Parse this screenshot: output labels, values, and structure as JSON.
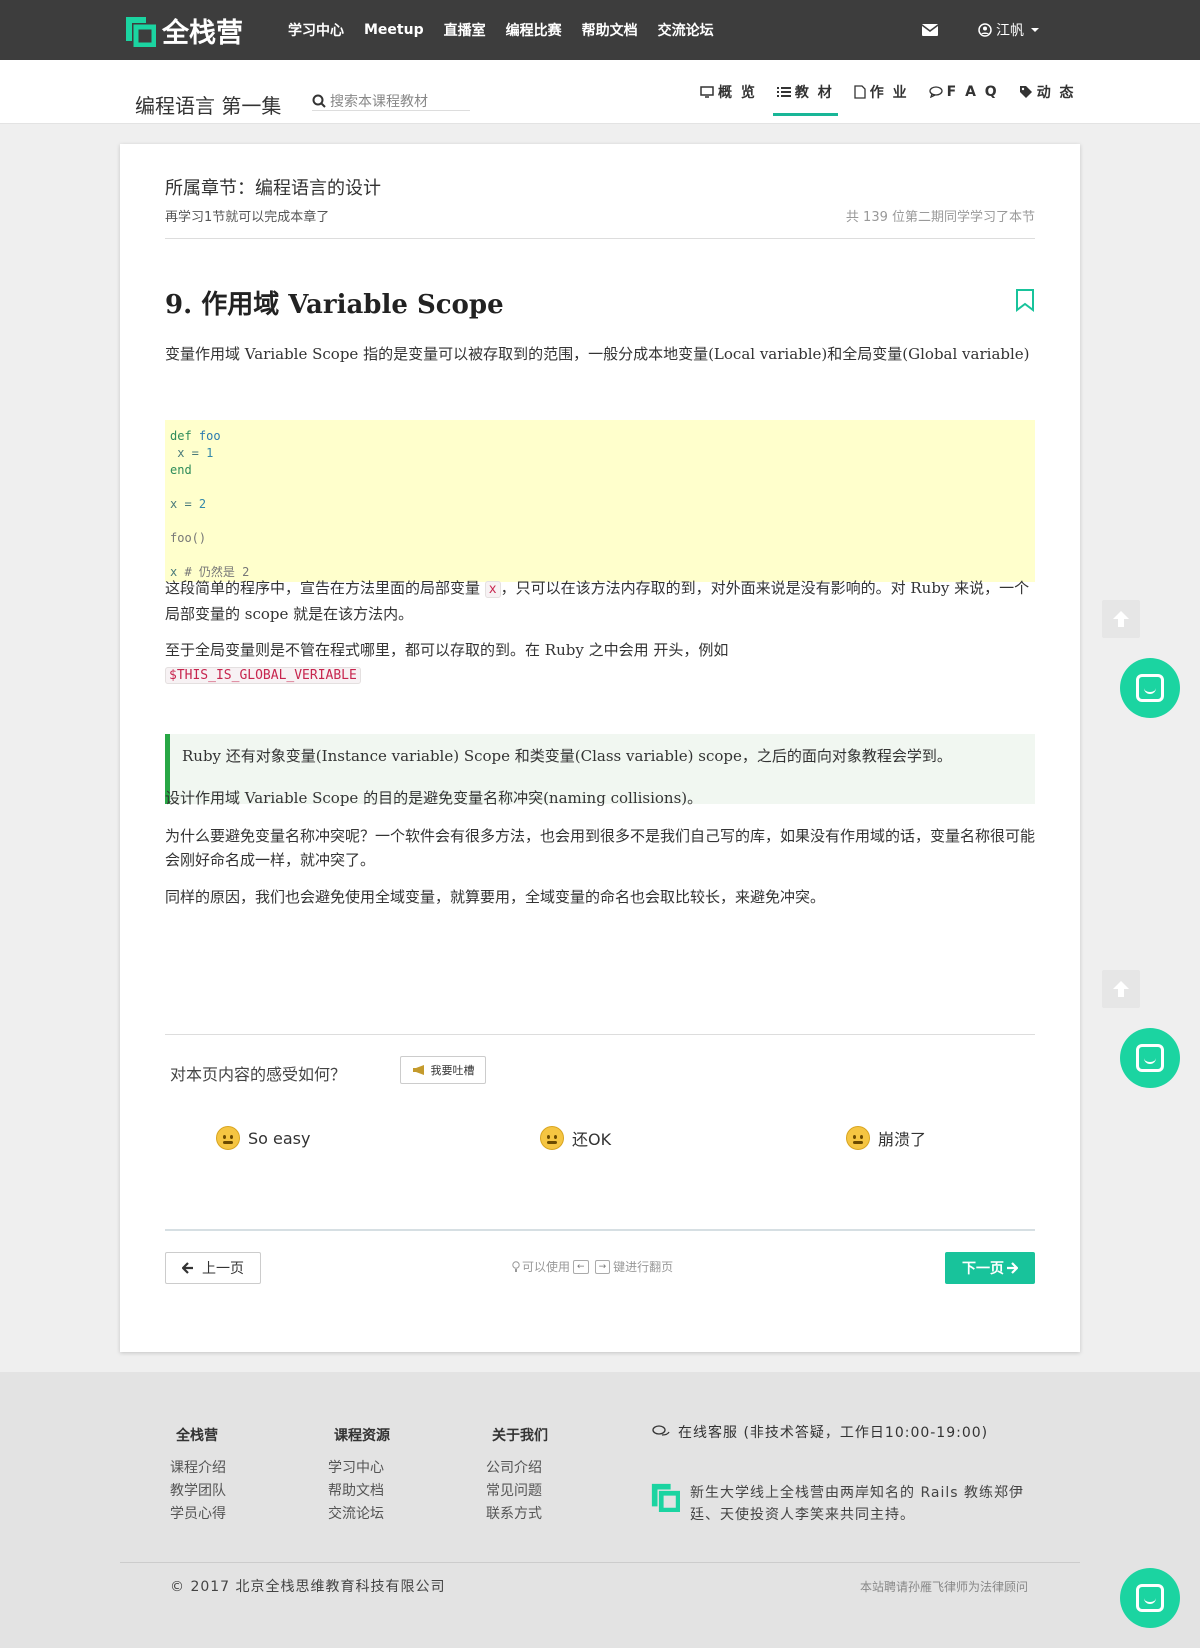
{
  "topnav": {
    "brand": "全栈营",
    "links": [
      "学习中心",
      "Meetup",
      "直播室",
      "编程比赛",
      "帮助文档",
      "交流论坛"
    ],
    "user": "江帆"
  },
  "subnav": {
    "course_title": "编程语言 第一集",
    "search_placeholder": "搜索本课程教材",
    "tabs": [
      "概 览",
      "教 材",
      "作 业",
      "F A Q",
      "动 态"
    ],
    "active_tab": 1
  },
  "lesson": {
    "chapter": "所属章节：编程语言的设计",
    "remaining": "再学习1节就可以完成本章了",
    "learners": "共 139 位第二期同学学习了本节",
    "title": "9. 作用域 Variable Scope",
    "p1": "变量作用域 Variable Scope 指的是变量可以被存取到的范围，一般分成本地变量(Local variable)和全局变量(Global variable)",
    "code": {
      "l1a": "def",
      "l1b": " foo",
      "l2a": " x = ",
      "l2b": "1",
      "l3": "end",
      "l5a": "x = ",
      "l5b": "2",
      "l7": "foo()",
      "l9a": "x ",
      "l9b": "# 仍然是 2"
    },
    "p2a": "这段简单的程序中，宣告在方法里面的局部变量 ",
    "p2code": "x",
    "p2b": "，只可以在该方法内存取的到，对外面来说是没有影响的。对 Ruby 来说，一个局部变量的 scope 就是在该方法内。",
    "p3a": "至于全局变量则是不管在程式哪里，都可以存取的到。在 Ruby 之中会用 开头，例如",
    "p3code": "$THIS_IS_GLOBAL_VERIABLE",
    "quote": "Ruby 还有对象变量(Instance variable) Scope 和类变量(Class variable) scope，之后的面向对象教程会学到。",
    "p4": "设计作用域 Variable Scope 的目的是避免变量名称冲突(naming collisions)。",
    "p5": "为什么要避免变量名称冲突呢？一个软件会有很多方法，也会用到很多不是我们自己写的库，如果没有作用域的话，变量名称很可能会刚好命名成一样，就冲突了。",
    "p6": "同样的原因，我们也会避免使用全域变量，就算要用，全域变量的命名也会取比较长，来避免冲突。"
  },
  "feedback": {
    "question": "对本页内容的感受如何？",
    "complain_button": "我要吐槽",
    "reactions": [
      "So easy",
      "还OK",
      "崩溃了"
    ]
  },
  "pager": {
    "prev": "上一页",
    "hint_a": "可以使用",
    "key_left": "←",
    "key_right": "→",
    "hint_b": "键进行翻页",
    "next": "下一页"
  },
  "footer": {
    "col1": {
      "title": "全栈营",
      "links": [
        "课程介绍",
        "教学团队",
        "学员心得"
      ]
    },
    "col2": {
      "title": "课程资源",
      "links": [
        "学习中心",
        "帮助文档",
        "交流论坛"
      ]
    },
    "col3": {
      "title": "关于我们",
      "links": [
        "公司介绍",
        "常见问题",
        "联系方式"
      ]
    },
    "support": "在线客服 (非技术答疑，工作日10:00-19:00)",
    "about": "新生大学线上全栈营由两岸知名的 Rails 教练郑伊廷、天使投资人李笑来共同主持。",
    "copyright": "© 2017 北京全栈思维教育科技有限公司",
    "legal": "本站聘请孙雁飞律师为法律顾问"
  },
  "colors": {
    "accent": "#18c39b",
    "nav_bg": "#3d3d3d",
    "code_bg": "#ffffcc",
    "quote_border": "#28a745"
  }
}
